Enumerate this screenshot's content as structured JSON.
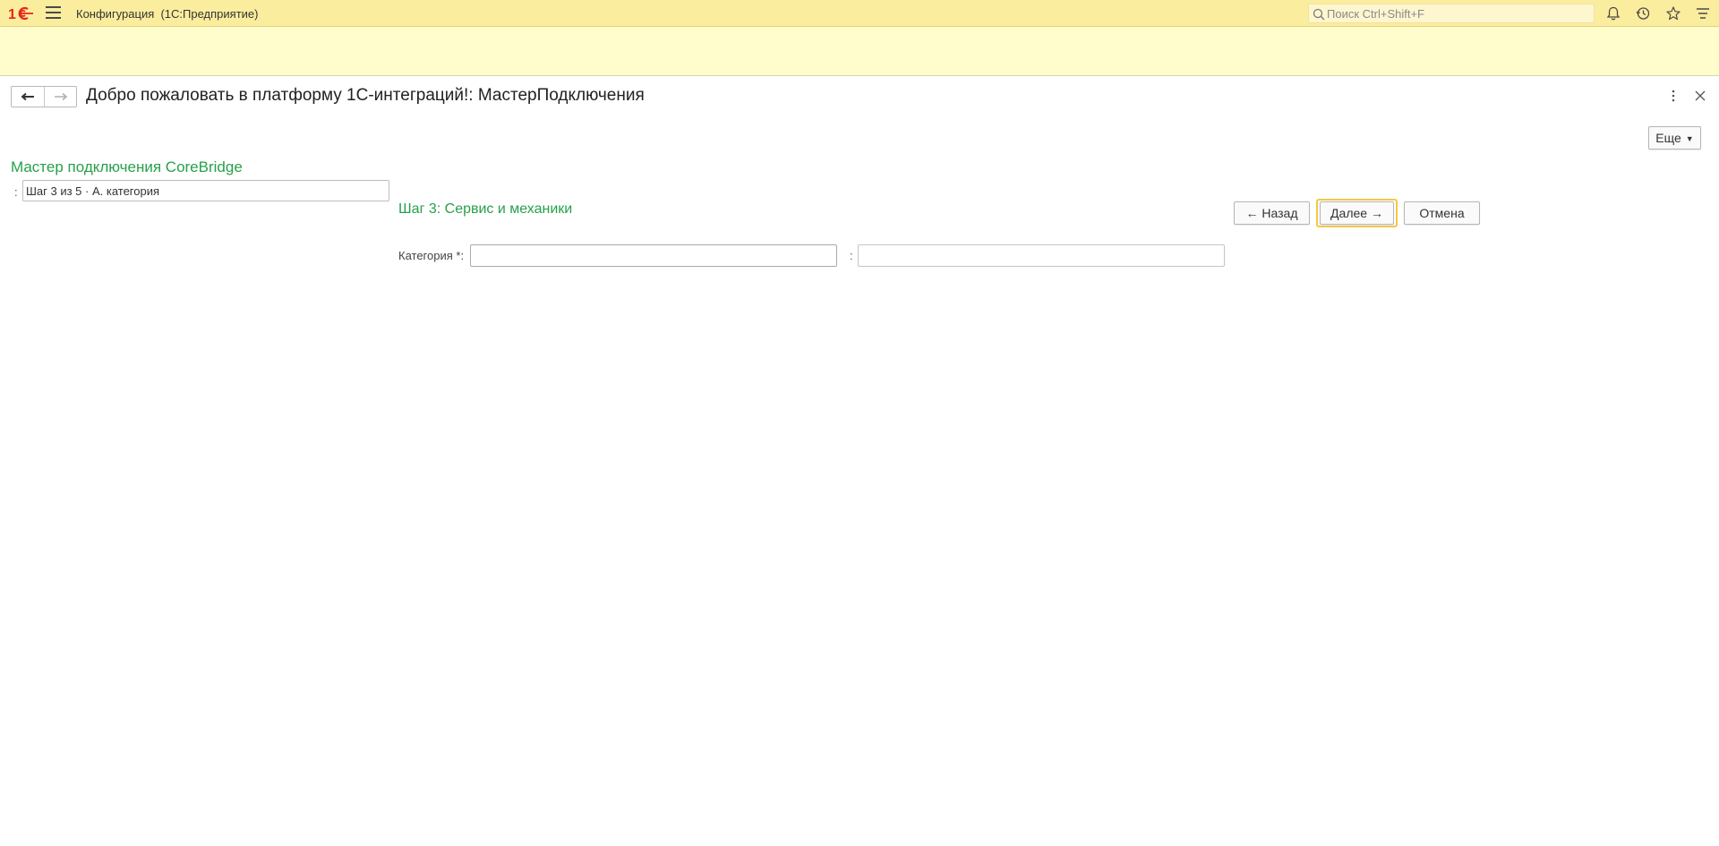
{
  "topbar": {
    "app_title": "Конфигурация  (1С:Предприятие)",
    "search_placeholder": "Поиск Ctrl+Shift+F",
    "brand_color": "#e8261c",
    "background": "#fbed9e",
    "icons": [
      "logo-1c-icon",
      "menu-icon",
      "search-icon",
      "bell-icon",
      "history-icon",
      "star-icon",
      "settings-lines-icon"
    ]
  },
  "form": {
    "title": "Добро пожаловать в платформу 1С-интеграций!: МастерПодключения",
    "more_label": "Еще",
    "wizard_title": "Мастер подключения CoreBridge",
    "step_colon": ":",
    "step_value": "Шаг 3 из 5 · А. категория",
    "step_heading": "Шаг 3: Сервис и механики",
    "buttons": {
      "back": "← Назад",
      "next": "Далее →",
      "cancel": "Отмена"
    },
    "category": {
      "label": "Категория *:",
      "value": "",
      "secondary_colon": ":",
      "secondary_value": ""
    },
    "accent_color": "#27a04a",
    "focus_color": "#f5c842"
  }
}
